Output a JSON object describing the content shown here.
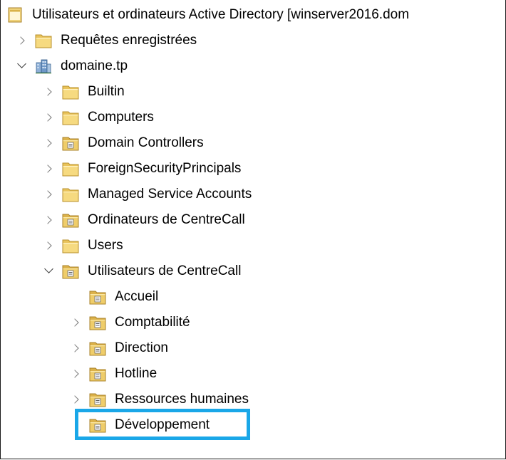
{
  "window": {
    "title": "Utilisateurs et ordinateurs Active Directory [winserver2016.dom"
  },
  "tree": {
    "saved_queries": "Requêtes enregistrées",
    "domain": {
      "label": "domaine.tp",
      "children": {
        "builtin": "Builtin",
        "computers": "Computers",
        "domain_controllers": "Domain Controllers",
        "foreign_security_principals": "ForeignSecurityPrincipals",
        "managed_service_accounts": "Managed Service Accounts",
        "ordinateurs_centrecall": "Ordinateurs de CentreCall",
        "users": "Users",
        "utilisateurs_centrecall": {
          "label": "Utilisateurs de CentreCall",
          "children": {
            "accueil": "Accueil",
            "comptabilite": "Comptabilité",
            "direction": "Direction",
            "hotline": "Hotline",
            "ressources_humaines": "Ressources humaines",
            "developpement": "Développement"
          }
        }
      }
    }
  },
  "colors": {
    "highlight_border": "#1aa7e8",
    "folder_fill": "#f3d77c",
    "ou_folder_fill": "#e9c45e"
  },
  "icons": {
    "root": "ad-snapin-icon",
    "folder": "folder-icon",
    "ou": "organizational-unit-icon",
    "domain": "domain-icon"
  }
}
